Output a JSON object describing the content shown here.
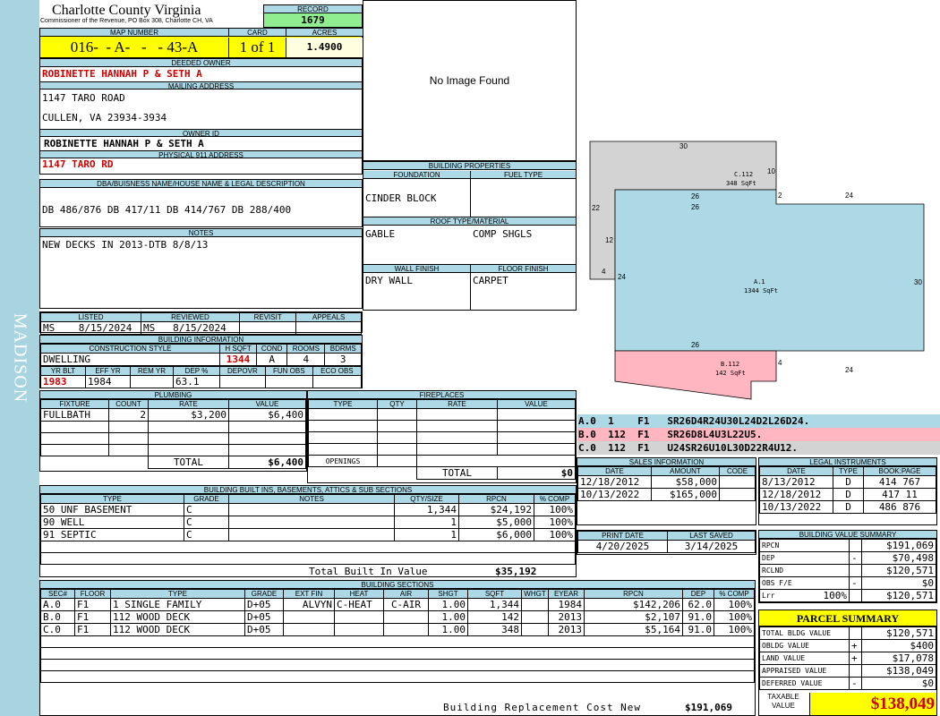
{
  "sidebar": {
    "text": "MADISON"
  },
  "header": {
    "county": "Charlotte County Virginia",
    "commissioner": "Commissioner of the Revenue, PO Box 308, Charlotte CH, VA",
    "record_label": "RECORD",
    "record": "1679"
  },
  "map": {
    "map_label": "MAP NUMBER",
    "map_number": "016-  - A-   -   - 43-A",
    "card_label": "CARD",
    "card": "1 of 1",
    "acres_label": "ACRES",
    "acres": "1.4900"
  },
  "owner": {
    "deeded_label": "DEEDED OWNER",
    "deeded": "ROBINETTE HANNAH P & SETH A",
    "mailing_label": "MAILING ADDRESS",
    "mail1": "1147 TARO ROAD",
    "mail2": "CULLEN, VA 23934-3934",
    "owner_id_label": "OWNER ID",
    "owner_id": "ROBINETTE HANNAH P & SETH A",
    "phys_label": "PHYSICAL 911 ADDRESS",
    "phys": "1147 TARO RD"
  },
  "legal": {
    "label": "DBA/BUISNESS NAME/HOUSE NAME & LEGAL DESCRIPTION",
    "text": "DB 486/876 DB 417/11 DB 414/767 DB 288/400"
  },
  "notes": {
    "label": "NOTES",
    "text": "NEW DECKS IN 2013-DTB 8/8/13"
  },
  "photo": {
    "text": "No Image Found"
  },
  "bprops": {
    "title": "BUILDING PROPERTIES",
    "found_label": "FOUNDATION",
    "found": "CINDER BLOCK",
    "fuel_label": "FUEL TYPE",
    "fuel": "",
    "roof_label": "ROOF TYPE/MATERIAL",
    "roof_type": "GABLE",
    "roof_mat": "COMP SHGLS",
    "wall_label": "WALL FINISH",
    "wall": "DRY WALL",
    "floor_label": "FLOOR FINISH",
    "floor": "CARPET"
  },
  "listing": {
    "listed_label": "LISTED",
    "reviewed_label": "REVIEWED",
    "revisit_label": "REVISIT",
    "appeals_label": "APPEALS",
    "listed_by": "MS",
    "listed": "8/15/2024",
    "reviewed_by": "MS",
    "reviewed": "8/15/2024",
    "revisit": "",
    "appeals": ""
  },
  "binfo": {
    "title": "BUILDING INFORMATION",
    "style_label": "CONSTRUCTION STYLE",
    "hsqft_label": "H SQFT",
    "cond_label": "COND",
    "rooms_label": "ROOMS",
    "bdrms_label": "BDRMS",
    "style": "DWELLING",
    "hsqft": "1344",
    "cond": "A",
    "rooms": "4",
    "bdrms": "3",
    "yrblt_label": "YR BLT",
    "effyr_label": "EFF YR",
    "remyr_label": "REM YR",
    "dep_label": "DEP %",
    "depovr_label": "DEPOVR",
    "funobs_label": "FUN OBS",
    "ecoobs_label": "ECO OBS",
    "yrblt": "1983",
    "effyr": "1984",
    "remyr": "",
    "dep": "63.1",
    "depovr": "",
    "funobs": "",
    "ecoobs": ""
  },
  "plumbing": {
    "title": "PLUMBING",
    "headers": [
      "FIXTURE",
      "COUNT",
      "RATE",
      "VALUE"
    ],
    "rows": [
      [
        "FULLBATH",
        "2",
        "$3,200",
        "$6,400"
      ],
      [
        "",
        "",
        "",
        ""
      ],
      [
        "",
        "",
        "",
        ""
      ],
      [
        "",
        "",
        "",
        ""
      ]
    ],
    "total_label": "TOTAL",
    "total": "$6,400"
  },
  "fireplaces": {
    "title": "FIREPLACES",
    "headers": [
      "TYPE",
      "QTY",
      "RATE",
      "VALUE"
    ],
    "openings_label": "OPENINGS",
    "total_label": "TOTAL",
    "total": "$0"
  },
  "builtins": {
    "title": "BUILDING BUILT INS, BASEMENTS, ATTICS & SUB SECTIONS",
    "headers": [
      "TYPE",
      "GRADE",
      "NOTES",
      "QTY/SIZE",
      "RPCN",
      "% COMP"
    ],
    "rows": [
      [
        "50 UNF BASEMENT",
        "C",
        "",
        "1,344",
        "$24,192",
        "100%"
      ],
      [
        "90 WELL",
        "C",
        "",
        "1",
        "$5,000",
        "100%"
      ],
      [
        "91 SEPTIC",
        "C",
        "",
        "1",
        "$6,000",
        "100%"
      ],
      [
        "",
        "",
        "",
        "",
        "",
        ""
      ],
      [
        "",
        "",
        "",
        "",
        "",
        ""
      ]
    ],
    "total_label": "Total Built In Value",
    "total": "$35,192"
  },
  "sections": {
    "title": "BUILDING SECTIONS",
    "headers": [
      "SEC#",
      "FLOOR",
      "TYPE",
      "GRADE",
      "EXT FIN",
      "HEAT",
      "AIR",
      "SHGT",
      "SQFT",
      "WHGT",
      "EYEAR",
      "RPCN",
      "DEP",
      "% COMP"
    ],
    "rows": [
      [
        "A.0",
        "F1",
        "1 SINGLE FAMILY",
        "D+05",
        "ALVYN",
        "C-HEAT",
        "C-AIR",
        "1.00",
        "1,344",
        "",
        "1984",
        "$142,206",
        "62.0",
        "100%"
      ],
      [
        "B.0",
        "F1",
        "112 WOOD DECK",
        "D+05",
        "",
        "",
        "",
        "1.00",
        "142",
        "",
        "2013",
        "$2,107",
        "91.0",
        "100%"
      ],
      [
        "C.0",
        "F1",
        "112 WOOD DECK",
        "D+05",
        "",
        "",
        "",
        "1.00",
        "348",
        "",
        "2013",
        "$5,164",
        "91.0",
        "100%"
      ]
    ],
    "rcn_label": "Building Replacement Cost New",
    "rcn": "$191,069"
  },
  "sketch": {
    "c_label": "C.112",
    "c_area": "348 SqFt",
    "a_label": "A.1",
    "a_area": "1344 SqFt",
    "b_label": "B.112",
    "b_area": "142 SqFt",
    "dims": {
      "c_top": "30",
      "c_right": "10",
      "c_mid": "26",
      "c_mid2": "26",
      "c_left": "22",
      "c_left2": "12",
      "c_bot": "4",
      "c_step": "2",
      "a_top": "24",
      "a_right": "30",
      "a_left": "24",
      "a_bot": "24",
      "a_mid": "26",
      "b_right": "4"
    },
    "colors": {
      "c": "#d3d3d3",
      "a": "#add8e6",
      "b": "#ffb6c1"
    },
    "lines": [
      {
        "text": "A.0  1    F1   SR26D4R24U30L24D2L26D24.",
        "color": "#add8e6"
      },
      {
        "text": "B.0  112  F1   SR26D8L4U3L22U5.",
        "color": "#ffb6c1"
      },
      {
        "text": "C.0  112  F1   U24SR26U10L30D22R4U12.",
        "color": "#d3d3d3"
      }
    ]
  },
  "sales": {
    "title": "SALES INFORMATION",
    "headers": [
      "DATE",
      "AMOUNT",
      "CODE"
    ],
    "rows": [
      [
        "12/18/2012",
        "$58,000",
        ""
      ],
      [
        "10/13/2022",
        "$165,000",
        ""
      ]
    ]
  },
  "legal_inst": {
    "title": "LEGAL INSTRUMENTS",
    "headers": [
      "DATE",
      "TYPE",
      "BOOK:PAGE"
    ],
    "rows": [
      [
        "8/13/2012",
        "D",
        "414 767"
      ],
      [
        "12/18/2012",
        "D",
        "417 11"
      ],
      [
        "10/13/2022",
        "D",
        "486 876"
      ]
    ]
  },
  "dates": {
    "print_label": "PRINT DATE",
    "print": "4/20/2025",
    "saved_label": "LAST SAVED",
    "saved": "3/14/2025"
  },
  "bvs": {
    "title": "BUILDING VALUE SUMMARY",
    "rows": [
      {
        "label": "RPCN",
        "sign": "",
        "value": "$191,069"
      },
      {
        "label": "DEP",
        "sign": "-",
        "value": "$70,498"
      },
      {
        "label": "RCLND",
        "sign": "",
        "value": "$120,571"
      },
      {
        "label": "OBS F/E",
        "sign": "-",
        "value": "$0"
      },
      {
        "label": "Lrr",
        "pct": "100%",
        "sign": "",
        "value": "$120,571"
      }
    ]
  },
  "parcel": {
    "title": "PARCEL SUMMARY",
    "rows": [
      {
        "label": "TOTAL BLDG VALUE",
        "sign": "",
        "value": "$120,571"
      },
      {
        "label": "OBLDG VALUE",
        "sign": "+",
        "value": "$400"
      },
      {
        "label": "LAND VALUE",
        "sign": "+",
        "value": "$17,078"
      },
      {
        "label": "APPRAISED VALUE",
        "sign": "",
        "value": "$138,049"
      },
      {
        "label": "DEFERRED VALUE",
        "sign": "-",
        "value": "$0"
      }
    ],
    "taxable_label": "TAXABLE VALUE",
    "taxable": "$138,049",
    "highlight": "#ffff00"
  }
}
